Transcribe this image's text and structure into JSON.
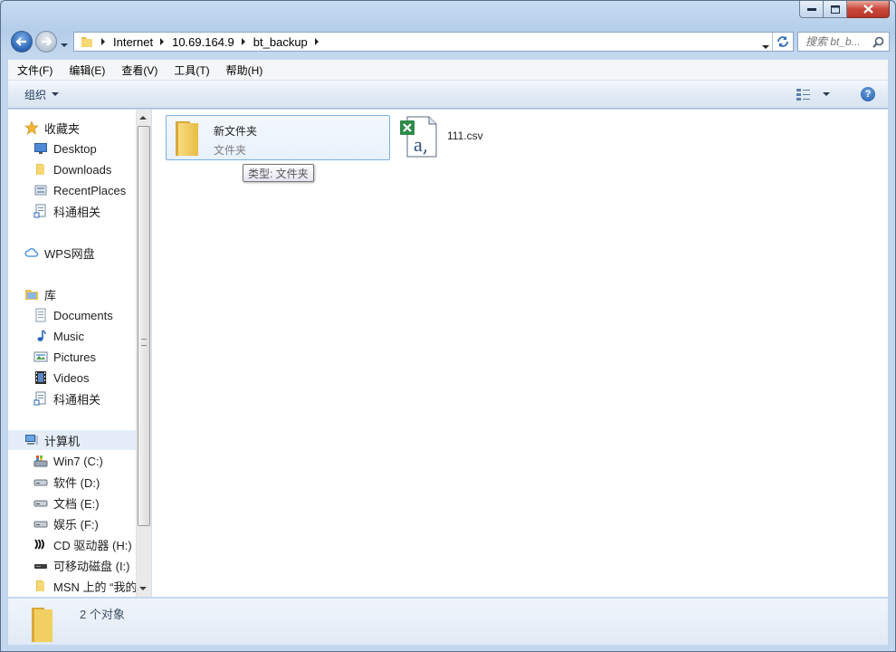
{
  "window": {
    "controls": {
      "minimize": "minimize",
      "maximize": "maximize",
      "close": "close"
    }
  },
  "address": {
    "crumbs": [
      "Internet",
      "10.69.164.9",
      "bt_backup"
    ]
  },
  "search": {
    "placeholder": "搜索 bt_b..."
  },
  "menu": [
    "文件(F)",
    "编辑(E)",
    "查看(V)",
    "工具(T)",
    "帮助(H)"
  ],
  "toolbar": {
    "organize_label": "组织"
  },
  "nav": {
    "favorites": {
      "label": "收藏夹",
      "items": [
        "Desktop",
        "Downloads",
        "RecentPlaces",
        "科通相关"
      ]
    },
    "wps": {
      "label": "WPS网盘"
    },
    "libraries": {
      "label": "库",
      "items": [
        "Documents",
        "Music",
        "Pictures",
        "Videos",
        "科通相关"
      ]
    },
    "computer": {
      "label": "计算机",
      "items": [
        "Win7 (C:)",
        "软件 (D:)",
        "文档 (E:)",
        "娱乐 (F:)",
        "CD 驱动器 (H:) I",
        "可移动磁盘 (I:)",
        "MSN 上的 “我的"
      ]
    }
  },
  "content": {
    "folder": {
      "name": "新文件夹",
      "type": "文件夹",
      "tooltip": "类型: 文件夹"
    },
    "file": {
      "name": "111.csv"
    }
  },
  "details": {
    "count": "2 个对象"
  },
  "colors": {
    "accent": "#3b78c9",
    "selection": "#e5eef8",
    "tile_border": "#7ab0e2",
    "close": "#c9473a"
  },
  "icons": [
    "back-arrow-icon",
    "forward-arrow-icon",
    "folder-icon",
    "refresh-icon",
    "search-icon",
    "star-icon",
    "desktop-icon",
    "recent-places-icon",
    "cloud-icon",
    "library-icon",
    "documents-icon",
    "music-icon",
    "pictures-icon",
    "videos-icon",
    "computer-icon",
    "drive-icon",
    "cd-drive-icon",
    "removable-drive-icon",
    "csv-file-icon",
    "help-icon",
    "view-options-icon"
  ]
}
